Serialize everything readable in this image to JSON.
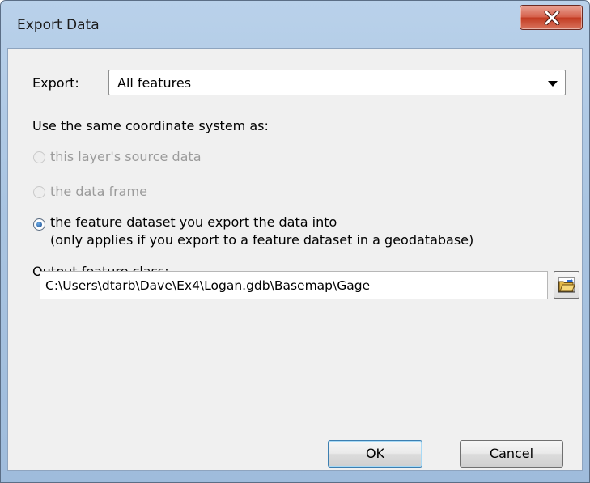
{
  "window": {
    "title": "Export Data"
  },
  "export": {
    "label": "Export:",
    "selected": "All features"
  },
  "coordinate": {
    "heading": "Use the same coordinate system as:",
    "options": [
      {
        "label": "this layer's source data",
        "enabled": false,
        "checked": false
      },
      {
        "label": "the data frame",
        "enabled": false,
        "checked": false
      },
      {
        "label": "the feature dataset you export the data into",
        "sublabel": "(only applies if you export to a feature dataset in a geodatabase)",
        "enabled": true,
        "checked": true
      }
    ]
  },
  "output": {
    "label": "Output feature class:",
    "value": "C:\\Users\\dtarb\\Dave\\Ex4\\Logan.gdb\\Basemap\\Gage"
  },
  "buttons": {
    "ok": "OK",
    "cancel": "Cancel"
  },
  "icons": {
    "close": "close-icon",
    "browse": "open-folder-icon"
  }
}
